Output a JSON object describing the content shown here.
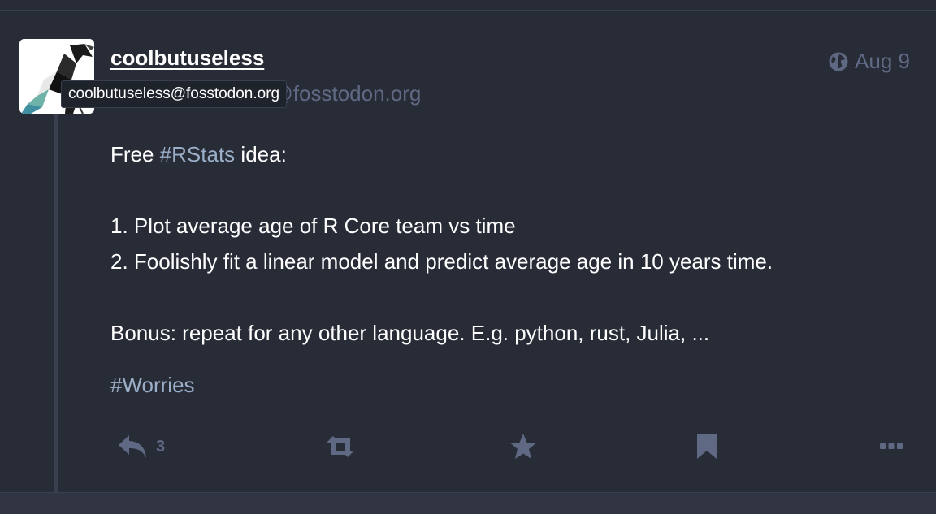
{
  "post": {
    "display_name": "coolbutuseless",
    "account_handle": "@coolbutuseless@fosstodon.org",
    "tooltip": "coolbutuseless@fosstodon.org",
    "timestamp": "Aug 9",
    "content": {
      "line1_prefix": "Free ",
      "line1_hashtag": "#RStats",
      "line1_suffix": " idea:",
      "item1": "1. Plot average age of R Core team vs time",
      "item2": "2. Foolishly fit a linear model and predict average age in 10 years time.",
      "bonus": "Bonus: repeat for any other language. E.g. python, rust, Julia, ..."
    },
    "tag": "#Worries"
  },
  "actions": {
    "reply_count": "3",
    "reply_icon": "reply-icon",
    "boost_icon": "boost-icon",
    "favourite_icon": "star-icon",
    "bookmark_icon": "bookmark-icon",
    "more_icon": "ellipsis-icon"
  },
  "colors": {
    "background": "#282c37",
    "muted_text": "#606984",
    "hashtag": "#9baec8",
    "primary_text": "#ffffff"
  }
}
